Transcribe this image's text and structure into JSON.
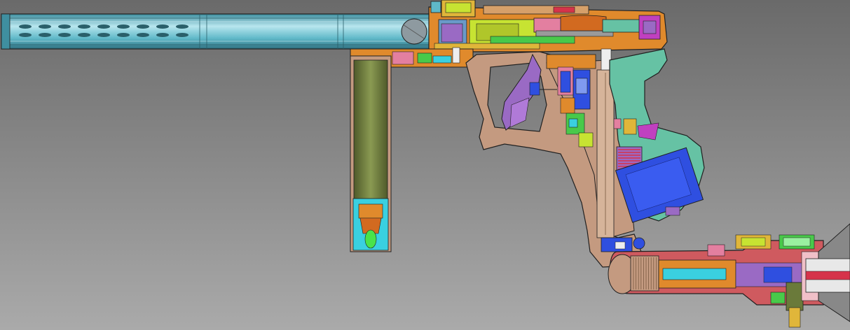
{
  "diagram": {
    "kind": "cad-cutaway",
    "labels": [],
    "colors": {
      "background_top": "#6a6a6a",
      "background_bottom": "#aaaaaa",
      "outline": "#202020",
      "barrel": "#5fb8c8",
      "barrel_highlight": "#b8e6ee",
      "receiver_tan": "#c49a80",
      "frame_orange": "#e08a2c",
      "grip_mint": "#66c2a4",
      "lime": "#c7e332",
      "pink": "#e37fa0",
      "purple": "#9a6ac4",
      "blue": "#2f4fe0",
      "magenta": "#c040c0",
      "red": "#d6334a",
      "olive": "#6a7a3a",
      "gold": "#e0b63a",
      "green": "#49c94a",
      "cyan": "#3ad0e0",
      "regulator_red": "#cf5a5f",
      "hose_gray": "#888888"
    }
  }
}
